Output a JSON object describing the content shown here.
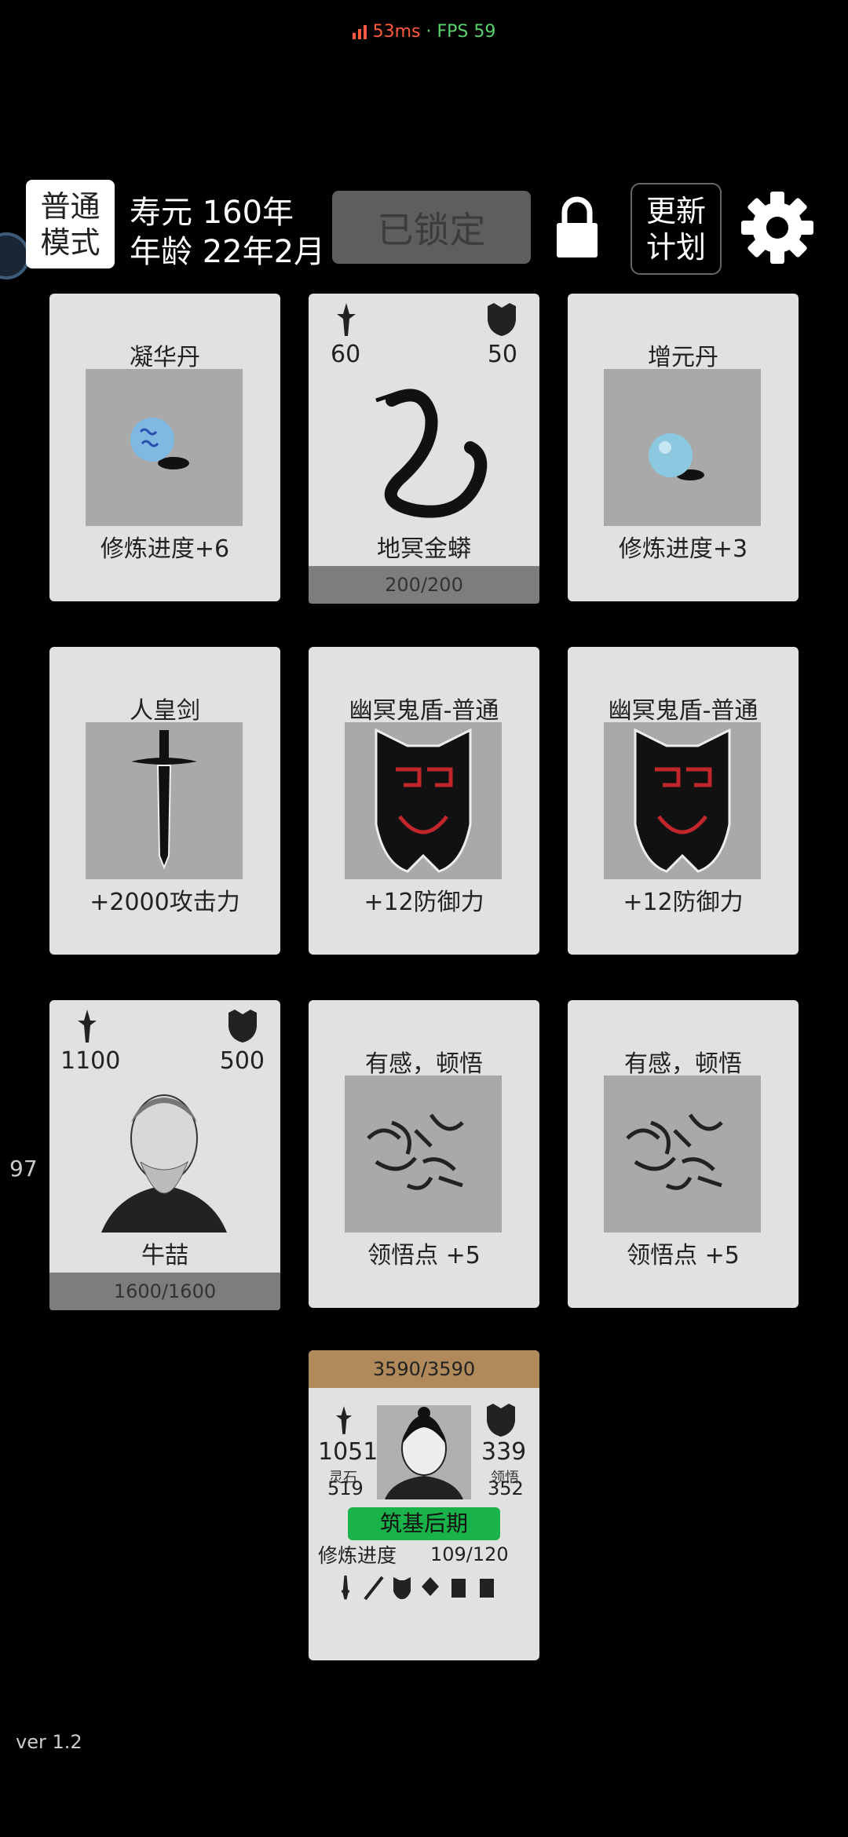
{
  "status_bar": {
    "ping": "53ms",
    "dot": "·",
    "fps": "FPS 59"
  },
  "header": {
    "mode_line1": "普通",
    "mode_line2": "模式",
    "lifespan": "寿元 160年",
    "age": "年龄 22年2月",
    "locked_label": "已锁定",
    "update_line1": "更新",
    "update_line2": "计划"
  },
  "cards": [
    {
      "title": "凝华丹",
      "desc": "修炼进度+6",
      "image": "blue-pill"
    },
    {
      "name": "地冥金蟒",
      "attack": "60",
      "defense": "50",
      "hp": "200/200",
      "image": "black-serpent"
    },
    {
      "title": "增元丹",
      "desc": "修炼进度+3",
      "image": "light-blue-pill"
    },
    {
      "title": "人皇剑",
      "desc": "+2000攻击力",
      "image": "black-sword"
    },
    {
      "title": "幽冥鬼盾-普通",
      "desc": "+12防御力",
      "image": "ghost-shield"
    },
    {
      "title": "幽冥鬼盾-普通",
      "desc": "+12防御力",
      "image": "ghost-shield"
    },
    {
      "name": "牛喆",
      "attack": "1100",
      "defense": "500",
      "hp": "1600/1600",
      "image": "old-man-portrait"
    },
    {
      "title": "有感，顿悟",
      "desc": "领悟点  +5",
      "image": "calligraphy"
    },
    {
      "title": "有感，顿悟",
      "desc": "领悟点  +5",
      "image": "calligraphy"
    }
  ],
  "side_number": "97",
  "player": {
    "hp": "3590/3590",
    "attack": "1051",
    "defense": "339",
    "spirit_stone_label": "灵石",
    "spirit_stone": "519",
    "insight_label": "领悟",
    "insight": "352",
    "realm": "筑基后期",
    "progress_label": "修炼进度",
    "progress": "109/120",
    "equipment_icons": [
      "sword-icon",
      "blade-icon",
      "mask-icon",
      "talisman-icon",
      "armor-icon",
      "armor-icon"
    ]
  },
  "version": "ver 1.2"
}
